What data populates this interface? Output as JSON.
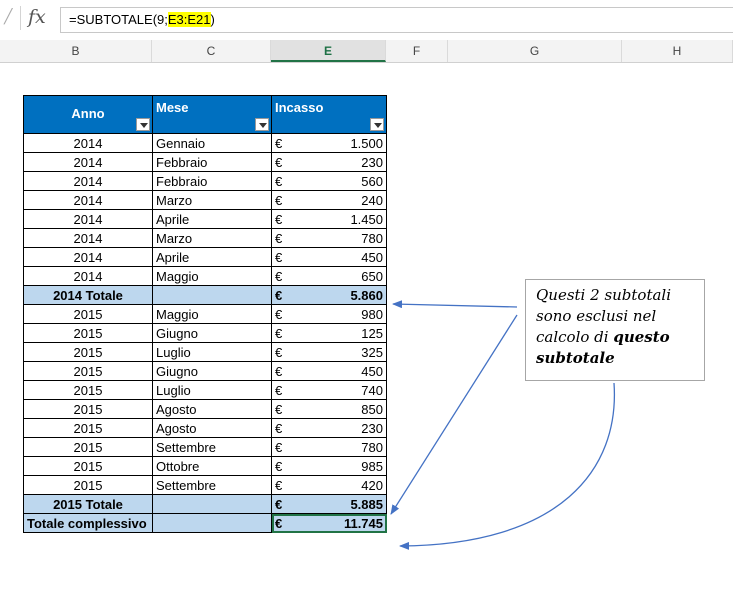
{
  "formula_bar": {
    "fx_label": "fx",
    "formula_prefix": "=SUBTOTALE(9;",
    "formula_ref": "E3:E21",
    "formula_suffix": ")"
  },
  "columns": [
    "B",
    "C",
    "E",
    "F",
    "G",
    "H"
  ],
  "selected_column": "E",
  "table": {
    "headers": [
      "Anno",
      "Mese",
      "Incasso"
    ],
    "currency": "€",
    "rows_2014": [
      {
        "anno": "2014",
        "mese": "Gennaio",
        "incasso": "1.500"
      },
      {
        "anno": "2014",
        "mese": "Febbraio",
        "incasso": "230"
      },
      {
        "anno": "2014",
        "mese": "Febbraio",
        "incasso": "560"
      },
      {
        "anno": "2014",
        "mese": "Marzo",
        "incasso": "240"
      },
      {
        "anno": "2014",
        "mese": "Aprile",
        "incasso": "1.450"
      },
      {
        "anno": "2014",
        "mese": "Marzo",
        "incasso": "780"
      },
      {
        "anno": "2014",
        "mese": "Aprile",
        "incasso": "450"
      },
      {
        "anno": "2014",
        "mese": "Maggio",
        "incasso": "650"
      }
    ],
    "subtotal_2014": {
      "label": "2014 Totale",
      "incasso": "5.860"
    },
    "rows_2015": [
      {
        "anno": "2015",
        "mese": "Maggio",
        "incasso": "980"
      },
      {
        "anno": "2015",
        "mese": "Giugno",
        "incasso": "125"
      },
      {
        "anno": "2015",
        "mese": "Luglio",
        "incasso": "325"
      },
      {
        "anno": "2015",
        "mese": "Giugno",
        "incasso": "450"
      },
      {
        "anno": "2015",
        "mese": "Luglio",
        "incasso": "740"
      },
      {
        "anno": "2015",
        "mese": "Agosto",
        "incasso": "850"
      },
      {
        "anno": "2015",
        "mese": "Agosto",
        "incasso": "230"
      },
      {
        "anno": "2015",
        "mese": "Settembre",
        "incasso": "780"
      },
      {
        "anno": "2015",
        "mese": "Ottobre",
        "incasso": "985"
      },
      {
        "anno": "2015",
        "mese": "Settembre",
        "incasso": "420"
      }
    ],
    "subtotal_2015": {
      "label": "2015 Totale",
      "incasso": "5.885"
    },
    "grand_total": {
      "label": "Totale complessivo",
      "incasso": "11.745"
    }
  },
  "annotation": {
    "line1": "Questi 2 subtotali",
    "line2": "sono esclusi nel",
    "line3_pre": "calcolo di ",
    "line3_bold": "questo",
    "line4_bold": "subtotale"
  },
  "colors": {
    "header_blue": "#0070c0",
    "subtotal_fill": "#bdd7ee",
    "arrow_blue": "#4472c4",
    "formula_highlight": "#ffff00"
  }
}
